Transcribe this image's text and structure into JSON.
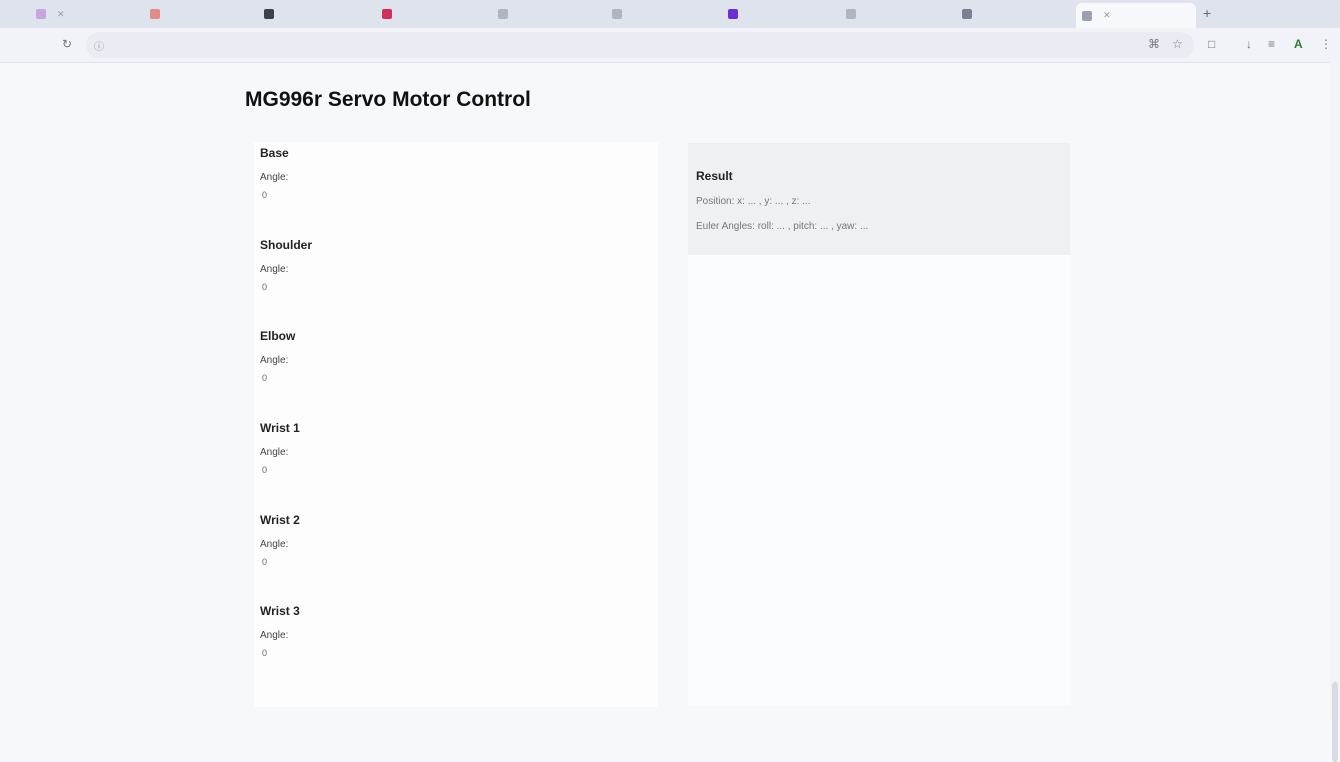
{
  "browser": {
    "tabs": [
      {
        "label": "",
        "favicon_color": "#c7a6e0"
      },
      {
        "label": "",
        "favicon_color": "#e28b8b"
      },
      {
        "label": "",
        "favicon_color": "#3c4150"
      },
      {
        "label": "",
        "favicon_color": "#d0305c"
      },
      {
        "label": "",
        "favicon_color": "#b0b5c0"
      },
      {
        "label": "",
        "favicon_color": "#b0b5c0"
      },
      {
        "label": "",
        "favicon_color": "#6b2fd0"
      },
      {
        "label": "",
        "favicon_color": "#b0b5c0"
      },
      {
        "label": "",
        "favicon_color": "#7a8090"
      },
      {
        "label": "",
        "favicon_color": "#9aa0ad"
      }
    ],
    "new_tab": "+",
    "url": ""
  },
  "page": {
    "title": "MG996r Servo Motor Control",
    "joints": [
      {
        "name": "Base",
        "angle_label": "Angle:",
        "angle_value": "0"
      },
      {
        "name": "Shoulder",
        "angle_label": "Angle:",
        "angle_value": "0"
      },
      {
        "name": "Elbow",
        "angle_label": "Angle:",
        "angle_value": "0"
      },
      {
        "name": "Wrist 1",
        "angle_label": "Angle:",
        "angle_value": "0"
      },
      {
        "name": "Wrist 2",
        "angle_label": "Angle:",
        "angle_value": "0"
      },
      {
        "name": "Wrist 3",
        "angle_label": "Angle:",
        "angle_value": "0"
      }
    ]
  },
  "result": {
    "title": "Result",
    "lines": [
      "Position: x: ... , y: ... , z: ...",
      "Euler Angles: roll: ... , pitch: ... , yaw: ..."
    ]
  },
  "colors": {
    "tab_bar": "#dfe3ee",
    "page_bg": "#f7f8fb",
    "result_bg": "#eef0f4"
  }
}
